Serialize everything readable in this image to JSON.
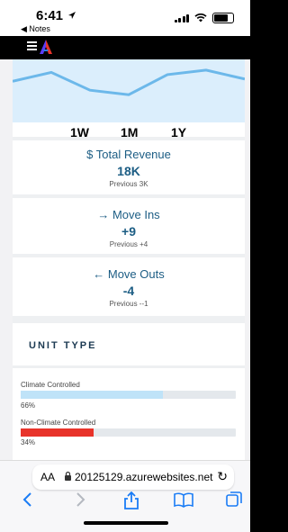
{
  "status": {
    "time": "6:41",
    "back_label": "◀ Notes"
  },
  "ranges": [
    "1W",
    "1M",
    "1Y"
  ],
  "stats": [
    {
      "icon": "$",
      "title": "Total Revenue",
      "value": "18K",
      "previous": "Previous 3K"
    },
    {
      "icon": "→",
      "title": "Move Ins",
      "value": "+9",
      "previous": "Previous +4"
    },
    {
      "icon": "←",
      "title": "Move Outs",
      "value": "-4",
      "previous": "Previous --1"
    }
  ],
  "unit_type": {
    "title": "UNIT TYPE",
    "rows": [
      {
        "label": "Climate Controlled",
        "percent_text": "66%",
        "fraction": 0.66,
        "color": "#bfe3f8"
      },
      {
        "label": "Non-Climate Controlled",
        "percent_text": "34%",
        "fraction": 0.34,
        "color": "#e8332a"
      }
    ]
  },
  "browser": {
    "text_size": "AA",
    "url": "20125129.azurewebsites.net"
  },
  "chart_data": {
    "type": "area",
    "x": [
      1,
      2,
      3,
      4,
      5,
      6,
      7
    ],
    "series": [
      {
        "values": [
          3.2,
          4.0,
          2.4,
          2.0,
          3.8,
          4.2,
          3.4
        ]
      }
    ],
    "ylim": [
      0,
      5
    ],
    "color": "#6cb8ea",
    "fill": "#dbeefc"
  }
}
